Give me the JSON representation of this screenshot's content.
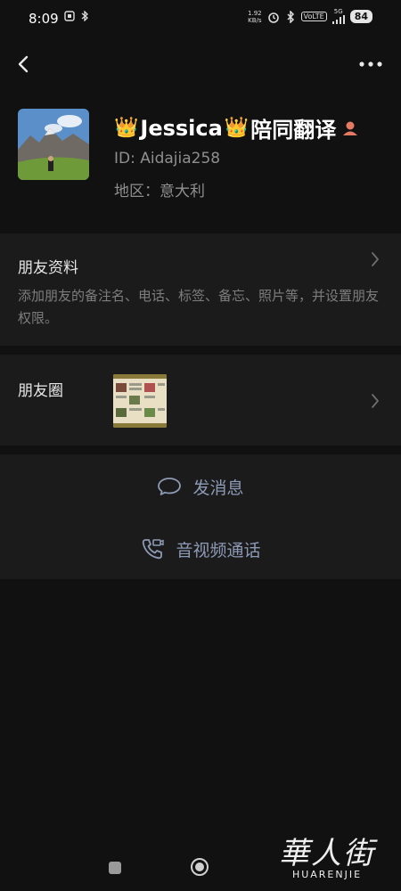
{
  "status_bar": {
    "time": "8:09",
    "net_speed_value": "1.92",
    "net_speed_unit": "KB/s",
    "volte": "VoLTE",
    "network": "5G",
    "battery": "84"
  },
  "profile": {
    "name": "Jessica",
    "crown_left": "👑",
    "crown_right": "👑",
    "name_suffix": "陪同翻译",
    "id": "ID:  Aidajia258",
    "region": "地区：意大利"
  },
  "friend_info": {
    "title": "朋友资料",
    "description": "添加朋友的备注名、电话、标签、备忘、照片等，并设置朋友权限。"
  },
  "moments": {
    "title": "朋友圈"
  },
  "actions": {
    "message": "发消息",
    "call": "音视频通话"
  },
  "watermark": {
    "big": "華人街",
    "small": "HUARENJIE"
  },
  "colors": {
    "background": "#111111",
    "card": "#1b1b1b",
    "action_text": "#8d9ab5",
    "secondary_text": "#7d7d7d"
  }
}
